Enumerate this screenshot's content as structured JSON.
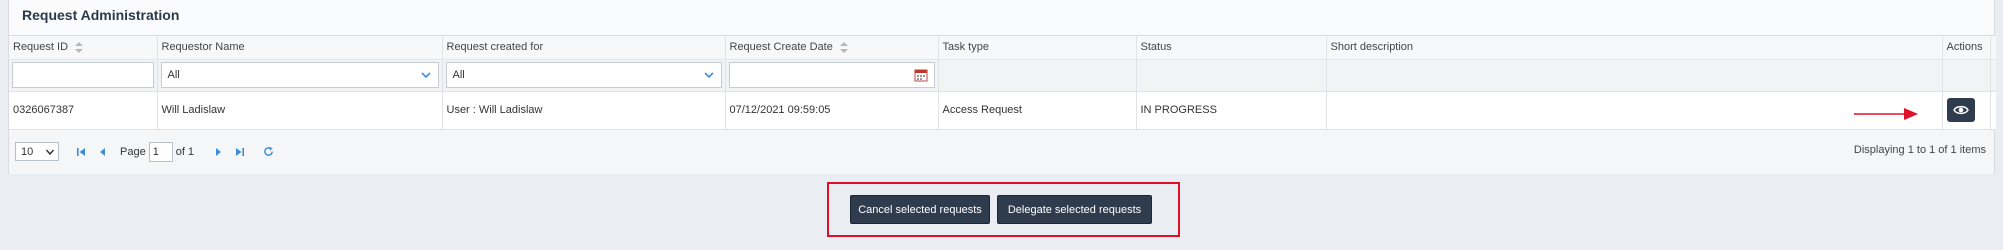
{
  "panel": {
    "title": "Request Administration"
  },
  "columns": [
    {
      "label": "Request ID",
      "sortable": true
    },
    {
      "label": "Requestor Name",
      "sortable": false
    },
    {
      "label": "Request created for",
      "sortable": false
    },
    {
      "label": "Request Create Date",
      "sortable": true
    },
    {
      "label": "Task type",
      "sortable": false
    },
    {
      "label": "Status",
      "sortable": false
    },
    {
      "label": "Short description",
      "sortable": false
    },
    {
      "label": "Actions",
      "sortable": false
    }
  ],
  "filters": {
    "requestor_name": "All",
    "created_for": "All",
    "create_date": ""
  },
  "rows": [
    {
      "request_id": "0326067387",
      "requestor_name": "Will Ladislaw",
      "created_for": "User : Will Ladislaw",
      "create_date": "07/12/2021 09:59:05",
      "task_type": "Access Request",
      "status": "IN PROGRESS",
      "short_description": ""
    }
  ],
  "pager": {
    "page_size": "10",
    "page_label": "Page",
    "current_page": "1",
    "of_label": "of 1",
    "info": "Displaying 1 to 1 of 1 items"
  },
  "buttons": {
    "cancel": "Cancel selected requests",
    "delegate": "Delegate selected requests"
  },
  "colors": {
    "accent_dark": "#2f3c4e",
    "highlight_red": "#e0102a",
    "pager_blue": "#3d8fd6"
  },
  "icons": {
    "sort": "sort-icon",
    "dropdown": "chevron-down-icon",
    "calendar": "calendar-icon",
    "view": "eye-icon",
    "first": "first-page-icon",
    "prev": "prev-page-icon",
    "next": "next-page-icon",
    "last": "last-page-icon",
    "refresh": "refresh-icon"
  }
}
